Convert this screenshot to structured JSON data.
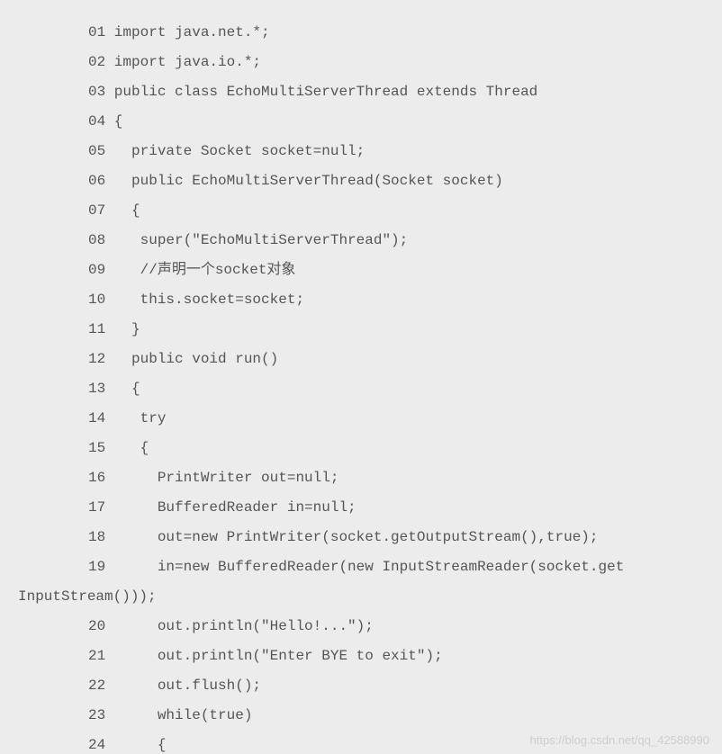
{
  "code": {
    "lines": [
      "01 import java.net.*;",
      "02 import java.io.*;",
      "03 public class EchoMultiServerThread extends Thread",
      "04 {",
      "05   private Socket socket=null;",
      "06   public EchoMultiServerThread(Socket socket)",
      "07   {",
      "08    super(\"EchoMultiServerThread\");",
      "09    //声明一个socket对象",
      "10    this.socket=socket;",
      "11   }",
      "12   public void run()",
      "13   {",
      "14    try",
      "15    {",
      "16      PrintWriter out=null;",
      "17      BufferedReader in=null;",
      "18      out=new PrintWriter(socket.getOutputStream(),true);",
      "19      in=new BufferedReader(new InputStreamReader(socket.get",
      "InputStream()));",
      "20      out.println(\"Hello!...\");",
      "21      out.println(\"Enter BYE to exit\");",
      "22      out.flush();",
      "23      while(true)",
      "24      {"
    ],
    "wrap_indices": [
      19
    ]
  },
  "watermark": "https://blog.csdn.net/qq_42588990"
}
